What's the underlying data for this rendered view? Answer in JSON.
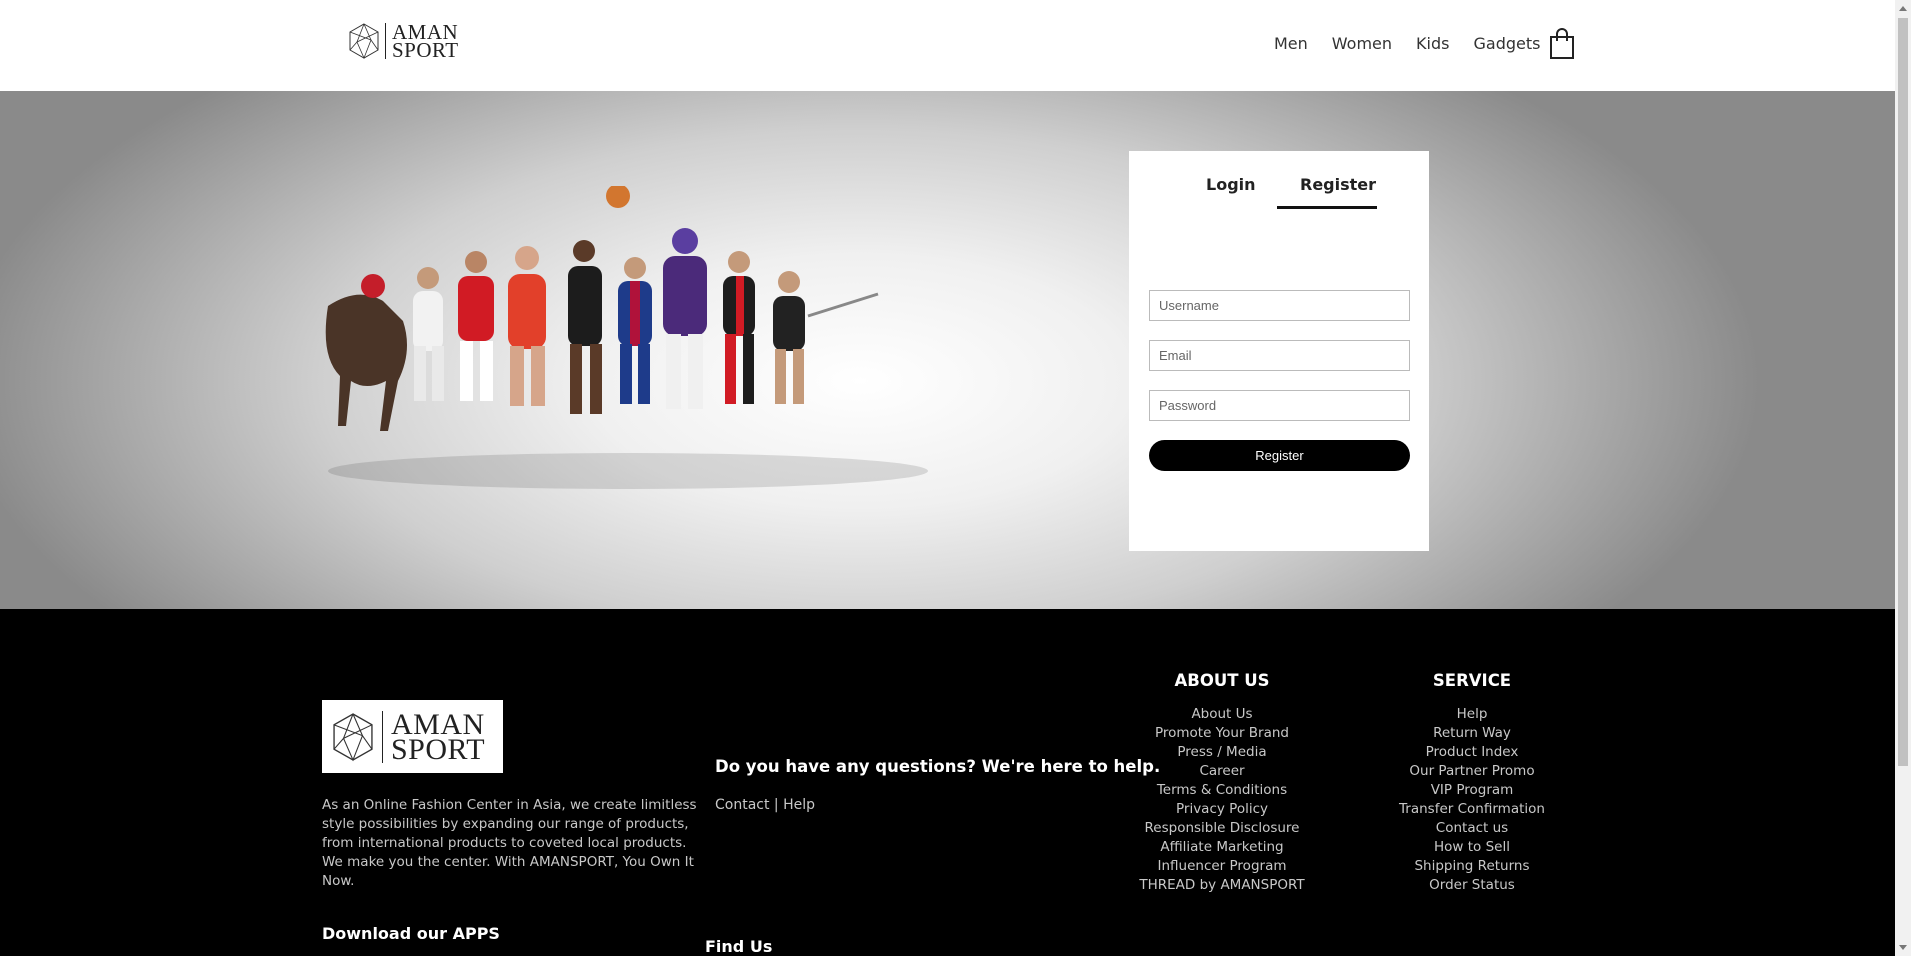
{
  "header": {
    "logo": {
      "line1": "AMAN",
      "line2": "SPORT"
    },
    "nav": [
      "Men",
      "Women",
      "Kids",
      "Gadgets"
    ],
    "cart_icon": "shopping-bag-icon"
  },
  "hero": {
    "image_icon": "athletes-image",
    "auth": {
      "tabs": {
        "login": "Login",
        "register": "Register"
      },
      "active_tab": "Register",
      "fields": {
        "username_placeholder": "Username",
        "email_placeholder": "Email",
        "password_placeholder": "Password"
      },
      "submit_label": "Register"
    }
  },
  "footer": {
    "logo": {
      "line1": "AMAN",
      "line2": "SPORT"
    },
    "description": "As an Online Fashion Center in Asia, we create limitless style possibilities by expanding our range of products, from international products to coveted local products. We make you the center. With AMANSPORT, You Own It Now.",
    "download_apps": "Download our APPS",
    "question": "Do you have any questions? We're here to help.",
    "contact": "Contact",
    "separator": "|",
    "help": "Help",
    "find_us": "Find Us",
    "about": {
      "title": "ABOUT US",
      "links": [
        "About Us",
        "Promote Your Brand",
        "Press / Media",
        "Career",
        "Terms & Conditions",
        "Privacy Policy",
        "Responsible Disclosure",
        "Affiliate Marketing",
        "Influencer Program",
        "THREAD by AMANSPORT"
      ]
    },
    "service": {
      "title": "SERVICE",
      "links": [
        "Help",
        "Return Way",
        "Product Index",
        "Our Partner Promo",
        "VIP Program",
        "Transfer Confirmation",
        "Contact us",
        "How to Sell",
        "Shipping Returns",
        "Order Status"
      ]
    }
  },
  "colors": {
    "accent": "#000000",
    "footer_bg": "#000000",
    "link_grey": "#c8c8c8"
  }
}
